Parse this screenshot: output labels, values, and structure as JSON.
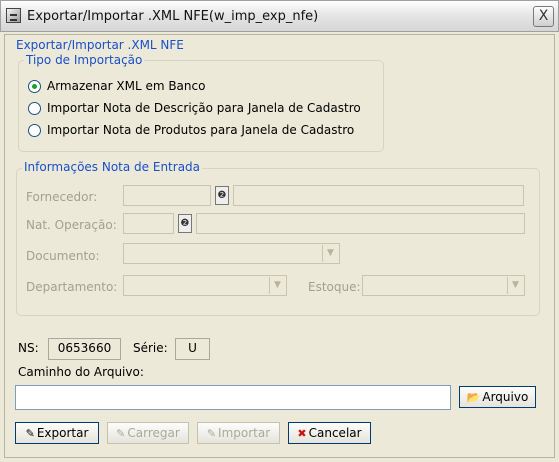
{
  "window": {
    "title": "Exportar/Importar .XML NFE(w_imp_exp_nfe)",
    "close_label": "X"
  },
  "main_group": {
    "legend": "Exportar/Importar .XML NFE"
  },
  "tipo_importacao": {
    "legend": "Tipo de Importação",
    "options": [
      {
        "label": "Armazenar XML em Banco",
        "checked": true
      },
      {
        "label": "Importar Nota de Descrição para Janela de Cadastro",
        "checked": false
      },
      {
        "label": "Importar Nota de Produtos para Janela de Cadastro",
        "checked": false
      }
    ]
  },
  "nota_entrada": {
    "legend": "Informações Nota de Entrada",
    "fornecedor_label": "Fornecedor:",
    "nat_operacao_label": "Nat. Operação:",
    "documento_label": "Documento:",
    "departamento_label": "Departamento:",
    "estoque_label": "Estoque:",
    "fornecedor_code": "",
    "fornecedor_name": "",
    "nat_operacao_code": "",
    "nat_operacao_name": "",
    "documento_value": "",
    "departamento_value": "",
    "estoque_value": ""
  },
  "ns": {
    "label": "NS:",
    "value": "0653660"
  },
  "serie": {
    "label": "Série:",
    "value": "U"
  },
  "caminho": {
    "label": "Caminho do Arquivo:",
    "value": ""
  },
  "buttons": {
    "arquivo": "Arquivo",
    "exportar": "Exportar",
    "carregar": "Carregar",
    "importar": "Importar",
    "cancelar": "Cancelar"
  }
}
